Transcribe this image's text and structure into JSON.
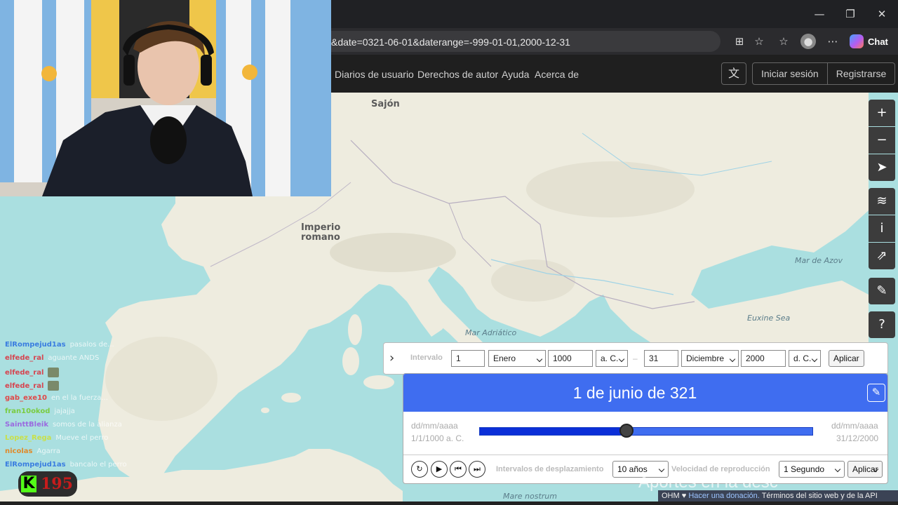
{
  "browser": {
    "url": "&date=0321-06-01&daterange=-999-01-01,2000-12-31",
    "chat_label": "Chat",
    "window_controls": [
      "minimize-icon",
      "restore-icon",
      "close-icon"
    ],
    "toolbar_icons": [
      "app-icon",
      "star-icon",
      "favorites-icon",
      "profile-avatar",
      "more-icon"
    ]
  },
  "site_header": {
    "nav": [
      "Diarios de usuario",
      "Derechos de autor",
      "Ayuda",
      "Acerca de"
    ],
    "language_icon": "translate-icon",
    "login": "Iniciar sesión",
    "register": "Registrarse"
  },
  "map": {
    "labels": {
      "saxony": "Sajón",
      "empire_line1": "Imperio",
      "empire_line2": "romano",
      "adriatic": "Mar Adriático",
      "azov": "Mar de Azov",
      "euxine": "Euxine Sea",
      "mare_nostrum": "Mare nostrum"
    },
    "colors": {
      "land": "#eeecdf",
      "sea": "#aadfe0",
      "accent": "#3f6df0"
    }
  },
  "map_controls": [
    "zoom-in-icon",
    "zoom-out-icon",
    "locate-icon",
    "layers-icon",
    "info-icon",
    "share-icon",
    "note-icon",
    "query-icon"
  ],
  "interval": {
    "label": "Intervalo",
    "start_day": "1",
    "start_month": "Enero",
    "start_year": "1000",
    "start_era": "a. C.",
    "separator": "–",
    "end_day": "31",
    "end_month": "Diciembre",
    "end_year": "2000",
    "end_era": "d. C.",
    "apply": "Aplicar"
  },
  "timeslider": {
    "current_date": "1 de junio de 321",
    "start_placeholder": "dd/mm/aaaa",
    "start_value": "1/1/1000 a. C.",
    "end_placeholder": "dd/mm/aaaa",
    "end_value": "31/12/2000",
    "position_fraction": 0.44,
    "step_label": "Intervalos de desplazamiento",
    "step_value": "10 años",
    "speed_label": "Velocidad de reproducción",
    "speed_value": "1 Segundo",
    "apply": "Aplicar"
  },
  "stream_chat": [
    {
      "user": "ElRompejud1as",
      "color": "#3a7de0",
      "msg": "pasalos de..."
    },
    {
      "user": "elfede_ral",
      "color": "#d64550",
      "msg": "aguante ANDS"
    },
    {
      "user": "elfede_ral",
      "color": "#d64550",
      "msg": ""
    },
    {
      "user": "elfede_ral",
      "color": "#d64550",
      "msg": ""
    },
    {
      "user": "gab_exe10",
      "color": "#e04848",
      "msg": "en el la fuerza..."
    },
    {
      "user": "fran10okod",
      "color": "#7acc40",
      "msg": "jajajja"
    },
    {
      "user": "SainttBleik",
      "color": "#9a6ae0",
      "msg": "somos de la alianza"
    },
    {
      "user": "Lopez_Rega",
      "color": "#c8e04a",
      "msg": "Mueve el perro"
    },
    {
      "user": "nicolas",
      "color": "#e08a2a",
      "msg": "Agarra"
    },
    {
      "user": "ElRompejud1as",
      "color": "#3a7de0",
      "msg": "bancalo el perro"
    }
  ],
  "kick_viewers": "195",
  "overlay_text": "Aportes en la desc",
  "attribution": {
    "ohm": "OHM",
    "heart": "♥",
    "donate": "Hacer una donación.",
    "terms": "Términos del sitio web y de la API"
  }
}
